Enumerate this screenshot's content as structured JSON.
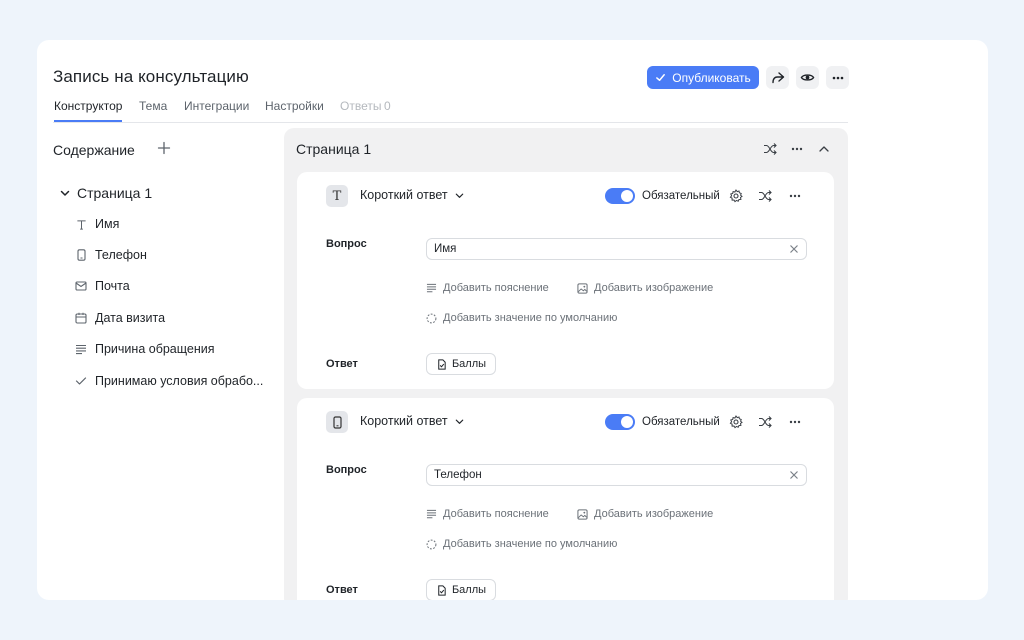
{
  "form": {
    "title": "Запись на консультацию",
    "publish_label": "Опубликовать"
  },
  "tabs": [
    {
      "label": "Конструктор"
    },
    {
      "label": "Тема"
    },
    {
      "label": "Интеграции"
    },
    {
      "label": "Настройки"
    },
    {
      "label": "Ответы"
    },
    {
      "label": "0"
    }
  ],
  "sidebar": {
    "heading": "Содержание",
    "page_label": "Страница 1",
    "items": [
      {
        "label": "Имя",
        "icon": "text-icon"
      },
      {
        "label": "Телефон",
        "icon": "phone-icon"
      },
      {
        "label": "Почта",
        "icon": "mail-icon"
      },
      {
        "label": "Дата визита",
        "icon": "calendar-icon"
      },
      {
        "label": "Причина обращения",
        "icon": "paragraph-icon"
      },
      {
        "label": "Принимаю условия обрабо...",
        "icon": "check-icon"
      }
    ]
  },
  "panel": {
    "title": "Страница 1"
  },
  "questions": [
    {
      "type_label": "Короткий ответ",
      "type_icon": "text-icon",
      "required_label": "Обязательный",
      "required_on": true,
      "question_label": "Вопрос",
      "question_value": "Имя",
      "add_hint": "Добавить пояснение",
      "add_image": "Добавить изображение",
      "add_default": "Добавить значение по умолчанию",
      "answer_label": "Ответ",
      "score_label": "Баллы"
    },
    {
      "type_label": "Короткий ответ",
      "type_icon": "phone-icon",
      "required_label": "Обязательный",
      "required_on": true,
      "question_label": "Вопрос",
      "question_value": "Телефон",
      "add_hint": "Добавить пояснение",
      "add_image": "Добавить изображение",
      "add_default": "Добавить значение по умолчанию",
      "answer_label": "Ответ",
      "score_label": "Баллы"
    }
  ],
  "colors": {
    "accent": "#4a7cf6",
    "background": "#eef4fb",
    "panel": "#f1f1f2"
  }
}
